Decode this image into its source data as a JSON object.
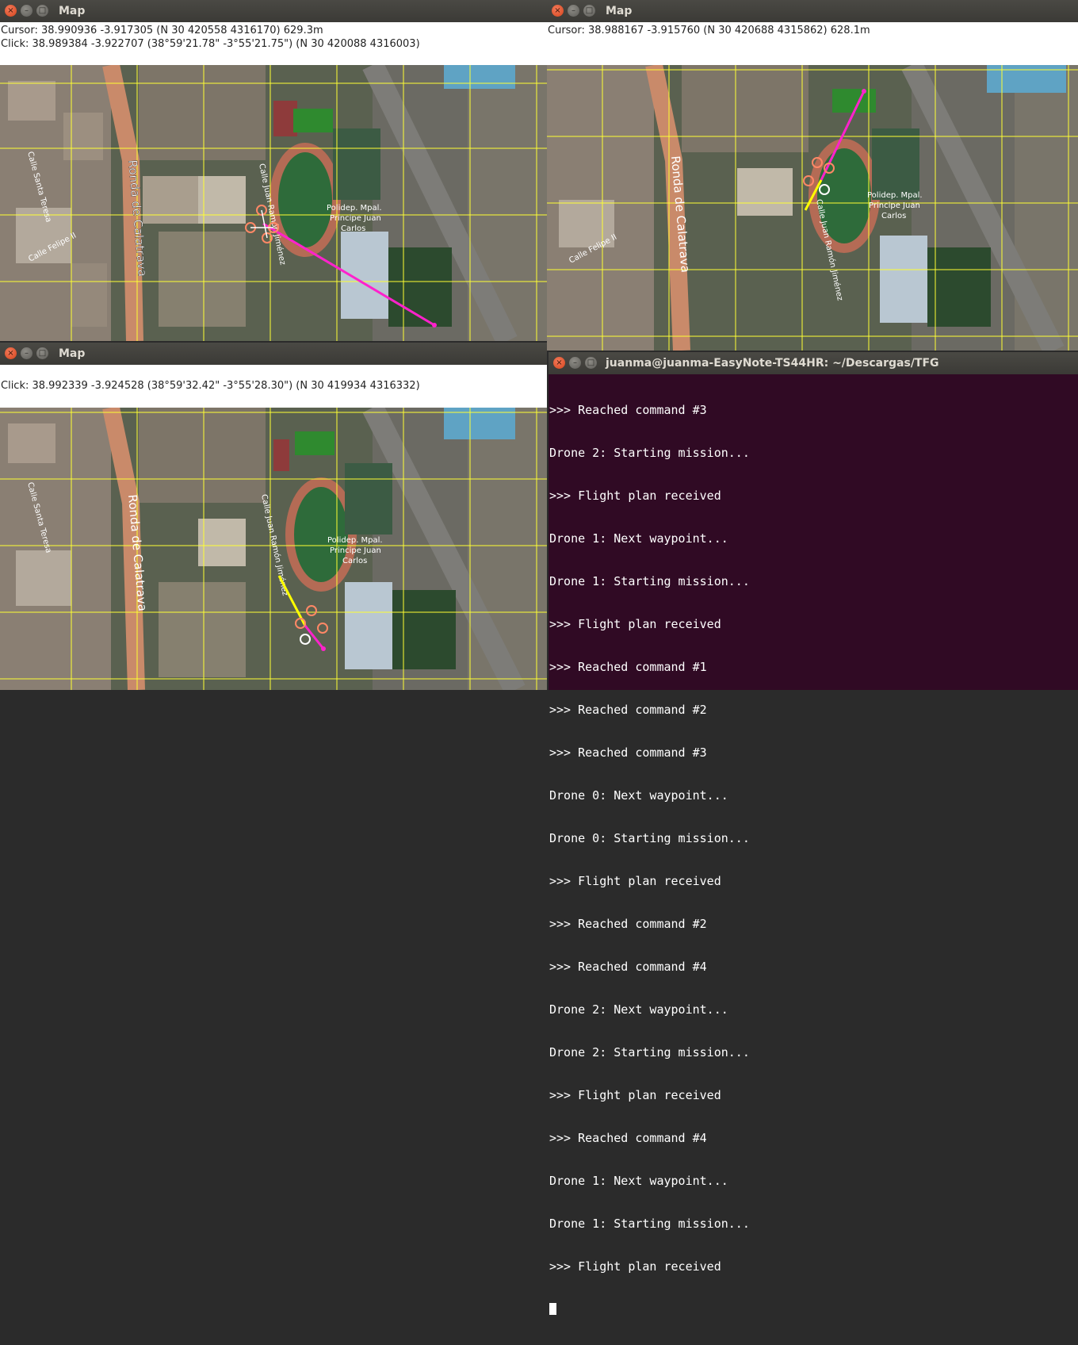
{
  "colors": {
    "terminal_bg": "#300a24",
    "grid": "#ffff33",
    "route_magenta": "#ff22cc",
    "route_yellow": "#ffff00",
    "drone_orange": "#ff8866",
    "field_green": "#2e6b3a",
    "track_red": "#b46b55"
  },
  "window_buttons": {
    "close": "×",
    "minimize": "–",
    "maximize": "□"
  },
  "map_labels": {
    "street_ronda": "Ronda de Calatrava",
    "street_santa_teresa": "Calle Santa Teresa",
    "street_felipe": "Calle Felipe II",
    "street_juan_ramon": "Calle Juan Ramón Jiménez",
    "poly_line1": "Polidep. Mpal.",
    "poly_line2": "Principe Juan",
    "poly_line3": "Carlos"
  },
  "windows": {
    "map_top_left": {
      "title": "Map",
      "cursor_text": "Cursor: 38.990936 -3.917305 (N 30 420558 4316170) 629.3m",
      "click_text": "Click: 38.989384 -3.922707 (38°59'21.78\" -3°55'21.75\") (N 30 420088 4316003)"
    },
    "map_top_right": {
      "title": "Map",
      "cursor_text": "Cursor: 38.988167 -3.915760 (N 30 420688 4315862) 628.1m"
    },
    "map_bottom_left": {
      "title": "Map",
      "click_text": "Click: 38.992339 -3.924528 (38°59'32.42\" -3°55'28.30\") (N 30 419934 4316332)"
    },
    "terminal": {
      "title": "juanma@juanma-EasyNote-TS44HR: ~/Descargas/TFG",
      "lines": [
        ">>> Reached command #3",
        "Drone 2: Starting mission...",
        ">>> Flight plan received",
        "Drone 1: Next waypoint...",
        "Drone 1: Starting mission...",
        ">>> Flight plan received",
        ">>> Reached command #1",
        ">>> Reached command #2",
        ">>> Reached command #3",
        "Drone 0: Next waypoint...",
        "Drone 0: Starting mission...",
        ">>> Flight plan received",
        ">>> Reached command #2",
        ">>> Reached command #4",
        "Drone 2: Next waypoint...",
        "Drone 2: Starting mission...",
        ">>> Flight plan received",
        ">>> Reached command #4",
        "Drone 1: Next waypoint...",
        "Drone 1: Starting mission...",
        ">>> Flight plan received"
      ]
    }
  }
}
